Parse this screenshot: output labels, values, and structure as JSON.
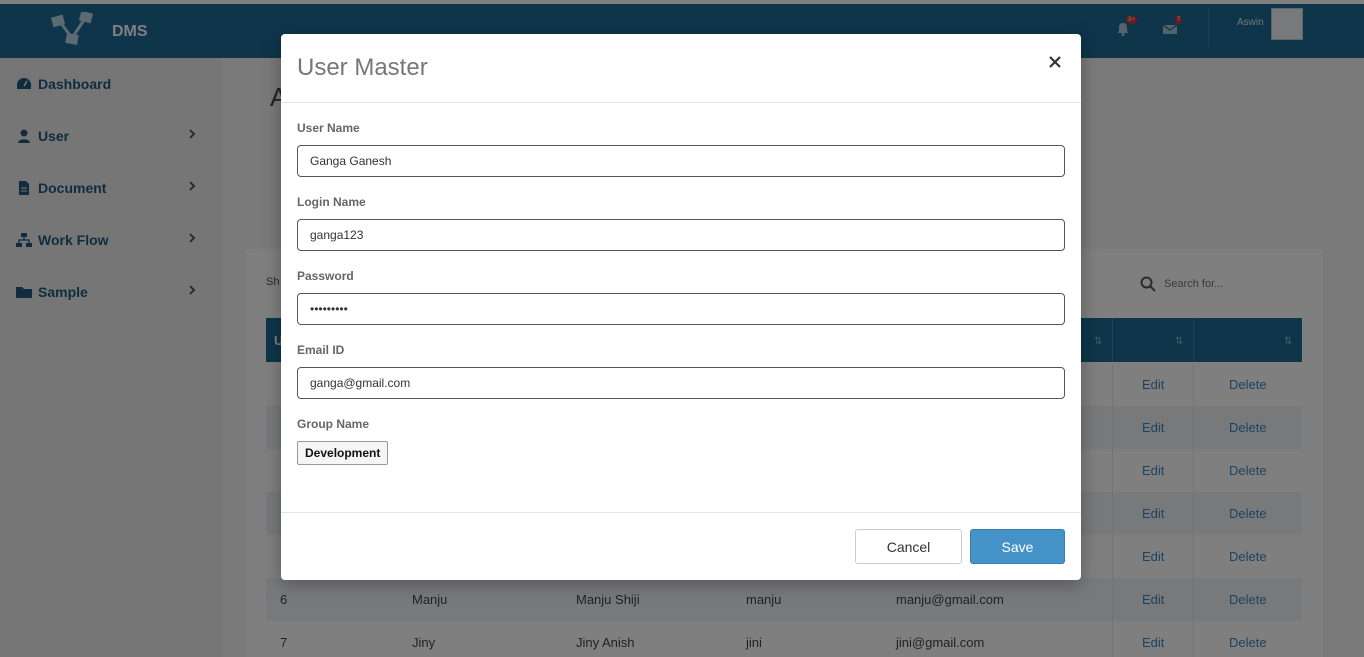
{
  "header": {
    "brand": "DMS",
    "notifications_badge": "3+",
    "messages_badge": "7",
    "username": "Aswin"
  },
  "sidebar": {
    "items": [
      {
        "label": "Dashboard",
        "icon": "dashboard-icon"
      },
      {
        "label": "User",
        "icon": "user-icon"
      },
      {
        "label": "Document",
        "icon": "document-icon"
      },
      {
        "label": "Work Flow",
        "icon": "workflow-icon"
      },
      {
        "label": "Sample",
        "icon": "folder-icon"
      }
    ]
  },
  "content": {
    "title_partial": "A",
    "show_label": "Sh",
    "search_placeholder": "Search for...",
    "first_header": "U",
    "rows": [
      {
        "edit": "Edit",
        "delete": "Delete"
      },
      {
        "edit": "Edit",
        "delete": "Delete"
      },
      {
        "edit": "Edit",
        "delete": "Delete"
      },
      {
        "edit": "Edit",
        "delete": "Delete"
      },
      {
        "edit": "Edit",
        "delete": "Delete"
      },
      {
        "id": "6",
        "name": "Manju",
        "full_name": "Manju Shiji",
        "login": "manju",
        "email": "manju@gmail.com",
        "edit": "Edit",
        "delete": "Delete"
      },
      {
        "id": "7",
        "name": "Jiny",
        "full_name": "Jiny Anish",
        "login": "jini",
        "email": "jini@gmail.com",
        "edit": "Edit",
        "delete": "Delete"
      }
    ]
  },
  "modal": {
    "title": "User Master",
    "user_name_label": "User Name",
    "user_name_value": "Ganga Ganesh",
    "login_name_label": "Login Name",
    "login_name_value": "ganga123",
    "password_label": "Password",
    "password_value": "ganga1234",
    "email_label": "Email ID",
    "email_value": "ganga@gmail.com",
    "group_name_label": "Group Name",
    "group_name_value": "Development",
    "cancel_label": "Cancel",
    "save_label": "Save"
  },
  "colors": {
    "header_bg": "#1d6a94",
    "save_button": "#4592c8",
    "sidebar_text": "#1f5a7e"
  }
}
